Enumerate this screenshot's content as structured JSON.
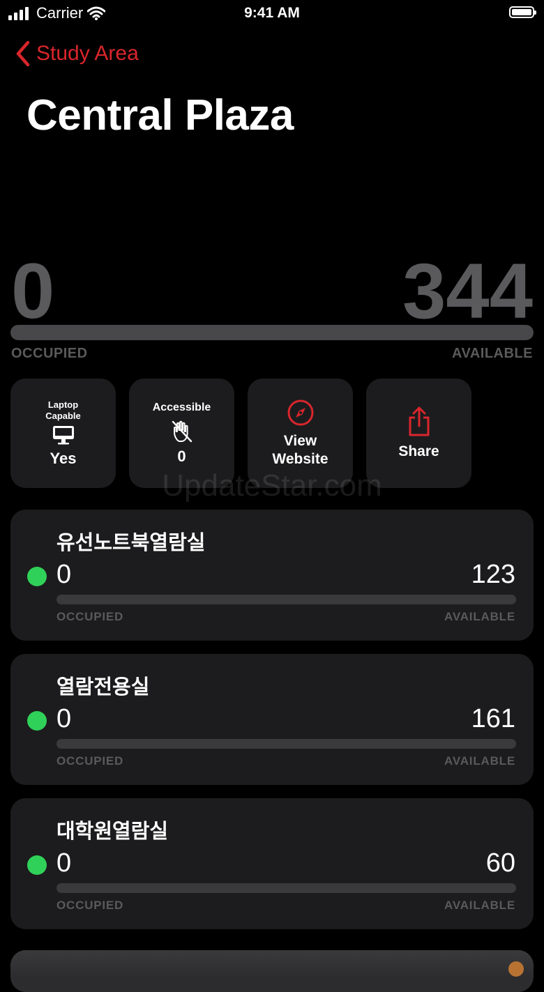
{
  "status_bar": {
    "carrier": "Carrier",
    "time": "9:41 AM"
  },
  "nav": {
    "back_label": "Study Area"
  },
  "title": "Central Plaza",
  "summary": {
    "occupied": "0",
    "available": "344",
    "occupied_label": "OCCUPIED",
    "available_label": "AVAILABLE",
    "occupancy_fraction": 0.0
  },
  "tiles": {
    "laptop": {
      "label": "Laptop Capable",
      "value": "Yes",
      "icon": "desktop-computer-icon"
    },
    "accessible": {
      "label": "Accessible",
      "value": "0",
      "icon": "hand-slash-icon"
    },
    "website": {
      "label": "View Website",
      "icon": "compass-icon"
    },
    "share": {
      "label": "Share",
      "icon": "share-icon"
    }
  },
  "watermark": "UpdateStar.com",
  "rooms": [
    {
      "name": "유선노트북열람실",
      "occupied": "0",
      "available": "123",
      "occupied_label": "OCCUPIED",
      "available_label": "AVAILABLE",
      "occupancy_fraction": 0.0
    },
    {
      "name": "열람전용실",
      "occupied": "0",
      "available": "161",
      "occupied_label": "OCCUPIED",
      "available_label": "AVAILABLE",
      "occupancy_fraction": 0.0
    },
    {
      "name": "대학원열람실",
      "occupied": "0",
      "available": "60",
      "occupied_label": "OCCUPIED",
      "available_label": "AVAILABLE",
      "occupancy_fraction": 0.0
    }
  ],
  "colors": {
    "accent": "#d9262c",
    "available_dot": "#30d158",
    "card": "#1c1c1e",
    "muted": "#5a5a5c"
  }
}
